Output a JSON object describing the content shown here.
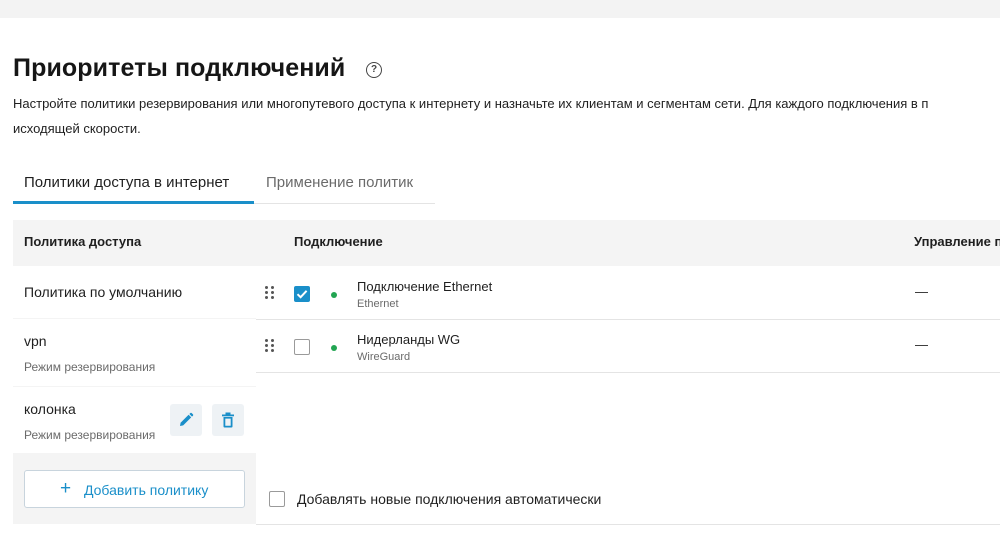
{
  "header": {
    "title": "Приоритеты подключений",
    "help_icon": "question-circle-icon",
    "description_line1": "Настройте политики резервирования или многопутевого доступа к интернету и назначьте их клиентам и сегментам сети. Для каждого подключения в п",
    "description_line2": "исходящей скорости."
  },
  "tabs": [
    {
      "label": "Политики доступа в интернет",
      "active": true
    },
    {
      "label": "Применение политик",
      "active": false
    }
  ],
  "policies": {
    "header": "Политика доступа",
    "items": [
      {
        "name": "Политика по умолчанию",
        "mode": ""
      },
      {
        "name": "vpn",
        "mode": "Режим резервирования"
      },
      {
        "name": "колонка",
        "mode": "Режим резервирования"
      }
    ],
    "add_label": "Добавить политику",
    "edit_icon": "pencil-icon",
    "delete_icon": "trash-icon"
  },
  "connections": {
    "columns": {
      "connection": "Подключение",
      "management": "Управление п"
    },
    "rows": [
      {
        "name": "Подключение Ethernet",
        "type": "Ethernet",
        "checked": true,
        "status": "online",
        "management": "—"
      },
      {
        "name": "Нидерланды WG",
        "type": "WireGuard",
        "checked": false,
        "status": "online",
        "management": "—"
      }
    ],
    "auto_add_label": "Добавлять новые подключения автоматически"
  },
  "colors": {
    "accent": "#1a8fc9",
    "status_online": "#22a552",
    "panel_bg": "#f4f4f4"
  }
}
